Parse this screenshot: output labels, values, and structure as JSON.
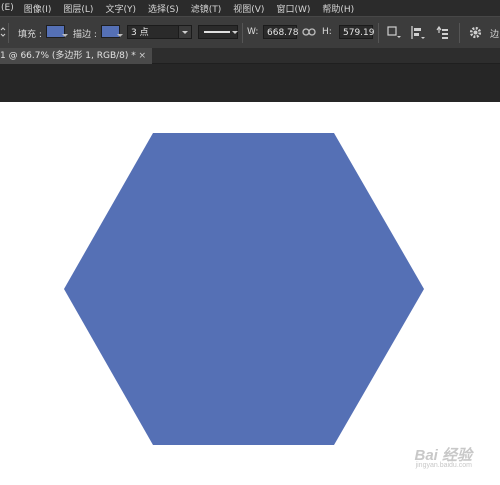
{
  "menu": [
    "(E)",
    "图像(I)",
    "图层(L)",
    "文字(Y)",
    "选择(S)",
    "滤镜(T)",
    "视图(V)",
    "窗口(W)",
    "帮助(H)"
  ],
  "options": {
    "fill_label": "填充 :",
    "stroke_label": "描边 :",
    "stroke_width": "3 点",
    "w_label": "W:",
    "w_value": "668.78",
    "h_label": "H:",
    "h_value": "579.19",
    "align_label": "边",
    "fill_color": "#5570b5",
    "stroke_color": "#5570b5"
  },
  "document": {
    "tab_title": "1 @ 66.7% (多边形 1, RGB/8) *",
    "close_glyph": "×"
  },
  "shape": {
    "type": "hexagon",
    "color": "#5570b5"
  },
  "watermark": {
    "text": "Bai 经验",
    "sub": "jingyan.baidu.com"
  }
}
